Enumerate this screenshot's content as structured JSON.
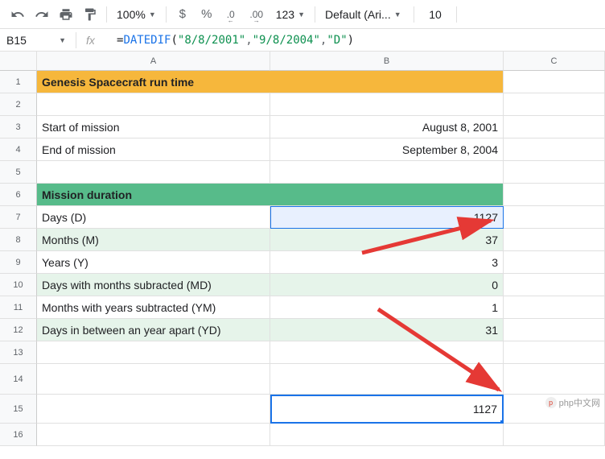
{
  "toolbar": {
    "zoom": "100%",
    "format_currency": "$",
    "format_percent": "%",
    "format_dec_dec": ".0",
    "format_dec_inc": ".00",
    "format_123": "123",
    "font": "Default (Ari...",
    "font_size": "10"
  },
  "namebox": "B15",
  "fx_label": "fx",
  "formula": {
    "eq": "=",
    "fn": "DATEDIF",
    "open": "(",
    "arg1": "\"8/8/2001\"",
    "c1": ",",
    "arg2": "\"9/8/2004\"",
    "c2": ",",
    "arg3": "\"D\"",
    "close": ")"
  },
  "columns": [
    "",
    "A",
    "B",
    "C"
  ],
  "rows": {
    "r1": {
      "num": "1",
      "a": "Genesis Spacecraft run time"
    },
    "r2": {
      "num": "2"
    },
    "r3": {
      "num": "3",
      "a": "Start of mission",
      "b": "August 8, 2001"
    },
    "r4": {
      "num": "4",
      "a": "End of mission",
      "b": "September 8, 2004"
    },
    "r5": {
      "num": "5"
    },
    "r6": {
      "num": "6",
      "a": "Mission duration"
    },
    "r7": {
      "num": "7",
      "a": "Days (D)",
      "b": "1127"
    },
    "r8": {
      "num": "8",
      "a": "Months (M)",
      "b": "37"
    },
    "r9": {
      "num": "9",
      "a": "Years (Y)",
      "b": "3"
    },
    "r10": {
      "num": "10",
      "a": "Days with months subracted (MD)",
      "b": "0"
    },
    "r11": {
      "num": "11",
      "a": "Months with years subtracted (YM)",
      "b": "1"
    },
    "r12": {
      "num": "12",
      "a": "Days in between an year apart (YD)",
      "b": "31"
    },
    "r13": {
      "num": "13"
    },
    "r14": {
      "num": "14"
    },
    "r15": {
      "num": "15",
      "b": "1127"
    },
    "r16": {
      "num": "16"
    }
  },
  "watermark": "php中文网"
}
